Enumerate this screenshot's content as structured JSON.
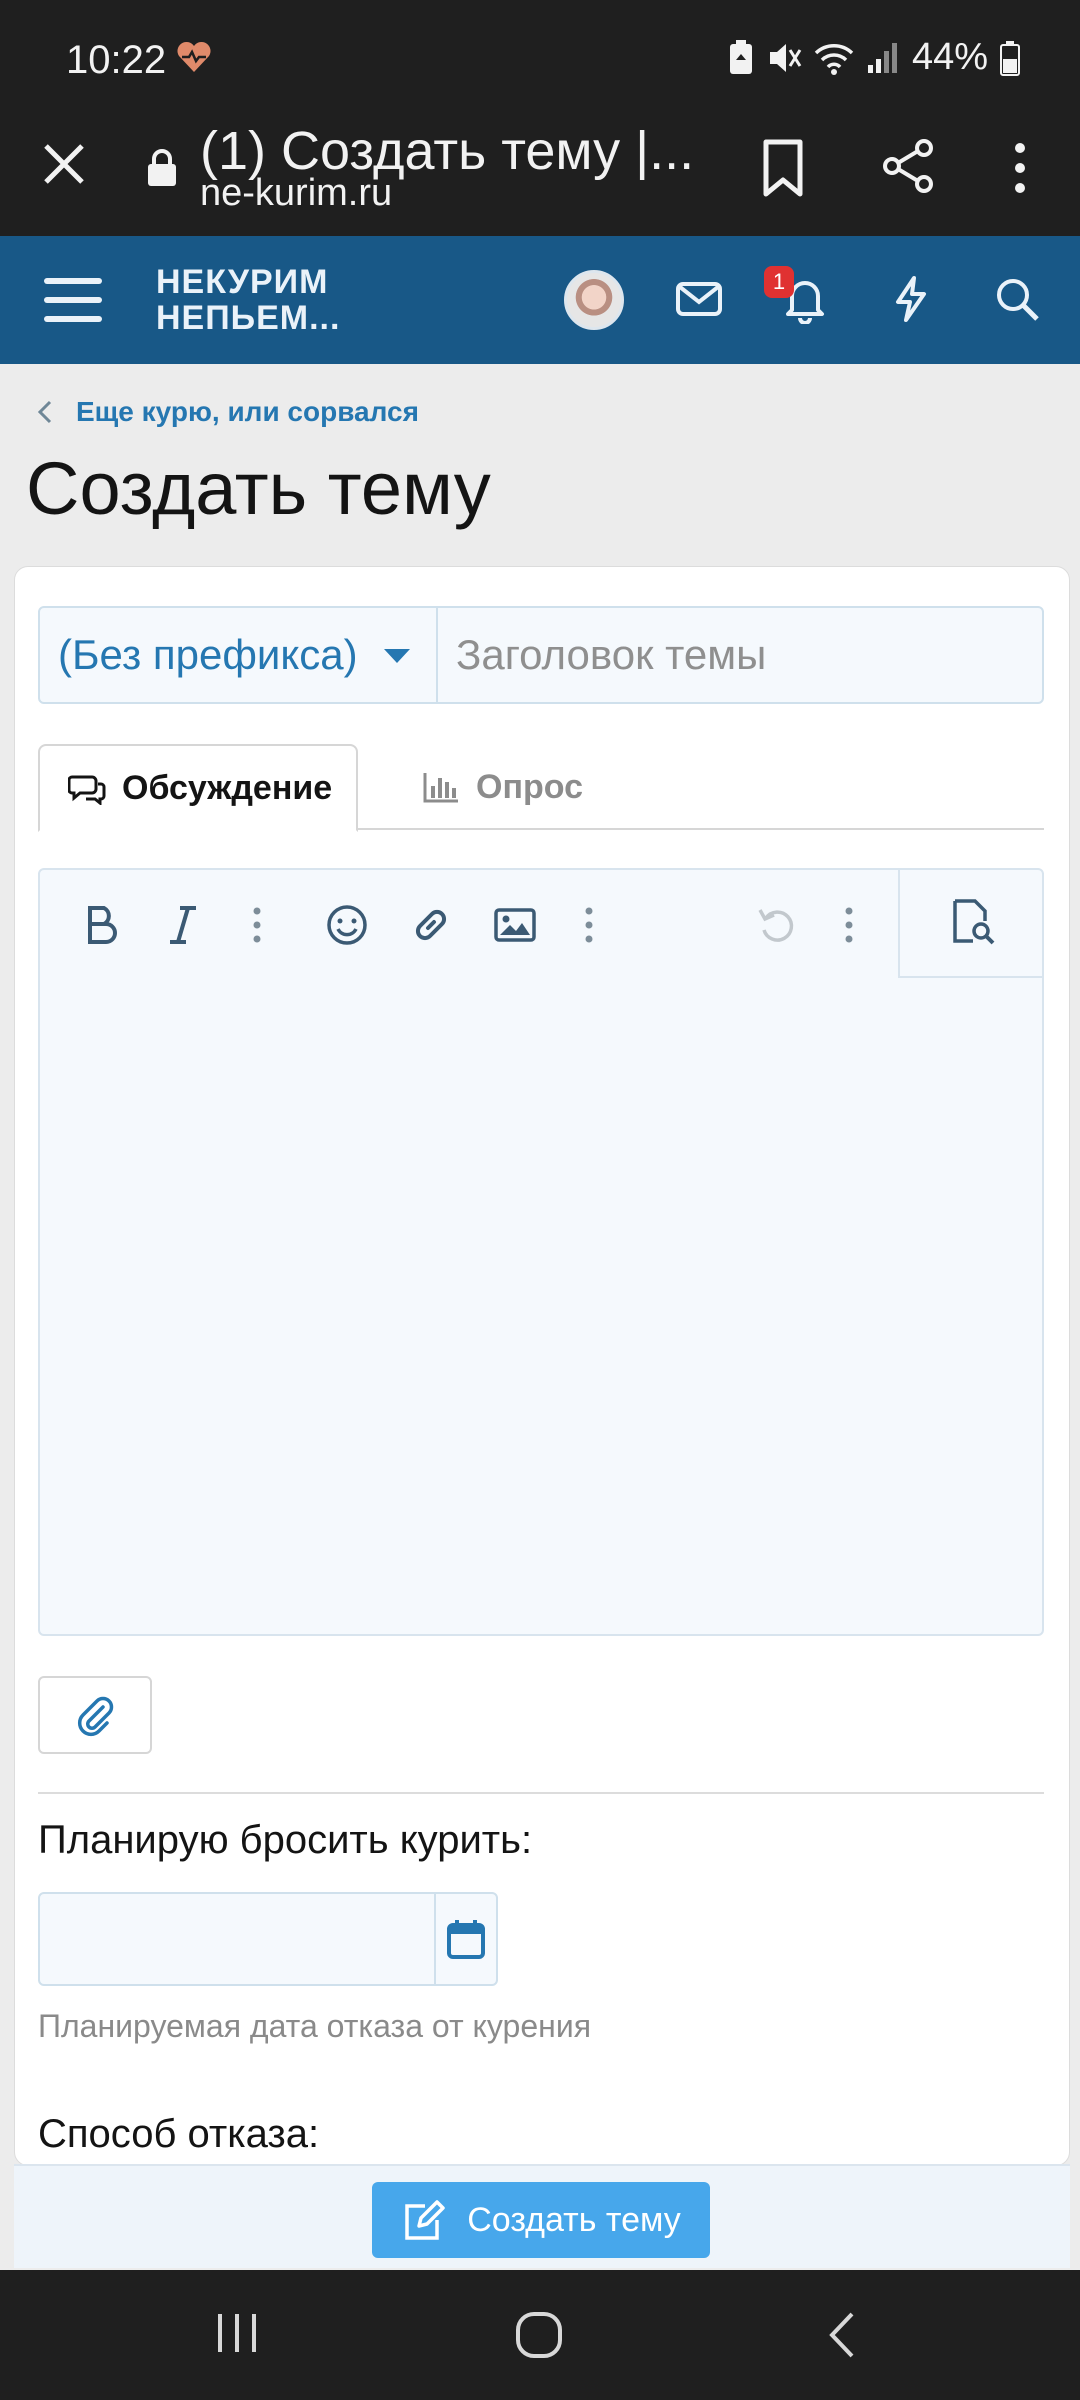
{
  "status_bar": {
    "time": "10:22",
    "battery": "44%",
    "icons": [
      "heart-rate-icon",
      "battery-saver-icon",
      "mute-icon",
      "wifi-icon",
      "signal-icon",
      "battery-icon"
    ]
  },
  "browser": {
    "tab_title": "(1) Создать тему |...",
    "domain": "ne-kurim.ru"
  },
  "site_header": {
    "logo_line1": "НЕКУРИМ",
    "logo_line2": "НЕПЬЕМ...",
    "alerts_badge": "1",
    "brand_color": "#185887"
  },
  "breadcrumb": {
    "label": "Еще курю, или сорвался"
  },
  "page": {
    "title": "Создать тему"
  },
  "form": {
    "prefix": "(Без префикса)",
    "title_placeholder": "Заголовок темы",
    "title_value": "",
    "tabs": [
      {
        "label": "Обсуждение",
        "active": true
      },
      {
        "label": "Опрос",
        "active": false
      }
    ],
    "editor_value": "",
    "quit_plan_label": "Планирую бросить курить:",
    "quit_date_value": "",
    "quit_date_hint": "Планируемая дата отказа от курения",
    "method_label": "Способ отказа:",
    "submit_label": "Создать тему",
    "accent_color": "#47a7eb"
  }
}
